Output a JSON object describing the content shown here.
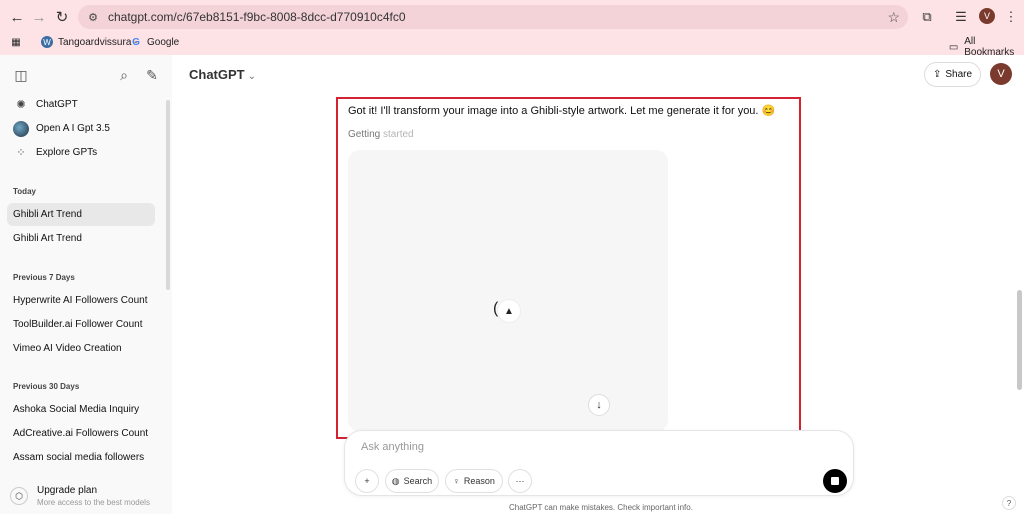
{
  "browser": {
    "url": "chatgpt.com/c/67eb8151-f9bc-8008-8dcc-d770910c4fc0",
    "profile_initial": "V",
    "bookmarks": [
      {
        "label": "Tangoardvissura -",
        "icon": "wordpress-icon"
      },
      {
        "label": "Google",
        "icon": "google-icon"
      }
    ],
    "all_bookmarks_label": "All Bookmarks"
  },
  "sidebar": {
    "top_items": [
      {
        "label": "ChatGPT",
        "icon": "chatgpt-logo-icon"
      },
      {
        "label": "Open A I Gpt 3.5",
        "icon": "gpt-avatar"
      },
      {
        "label": "Explore GPTs",
        "icon": "grid-icon"
      }
    ],
    "sections": [
      {
        "title": "Today",
        "items": [
          "Ghibli Art Trend",
          "Ghibli Art Trend"
        ]
      },
      {
        "title": "Previous 7 Days",
        "items": [
          "Hyperwrite AI Followers Count",
          "ToolBuilder.ai Follower Count",
          "Vimeo AI Video Creation"
        ]
      },
      {
        "title": "Previous 30 Days",
        "items": [
          "Ashoka Social Media Inquiry",
          "AdCreative.ai Followers Count",
          "Assam social media followers"
        ]
      }
    ],
    "upgrade": {
      "title": "Upgrade plan",
      "subtitle": "More access to the best models"
    }
  },
  "header": {
    "model": "ChatGPT",
    "share_label": "Share",
    "user_initial": "V"
  },
  "conversation": {
    "assistant_message": "Got it! I'll transform your image into a Ghibli-style artwork. Let me generate it for you. 😊",
    "status_dark": "Getting",
    "status_light": " started"
  },
  "composer": {
    "placeholder": "Ask anything",
    "search_label": "Search",
    "reason_label": "Reason",
    "more_label": "···"
  },
  "footer": {
    "disclaimer": "ChatGPT can make mistakes. Check important info.",
    "help": "?"
  },
  "colors": {
    "highlight_border": "#d32333",
    "browser_chrome": "#fde2e6",
    "avatar": "#7a3b2e"
  }
}
